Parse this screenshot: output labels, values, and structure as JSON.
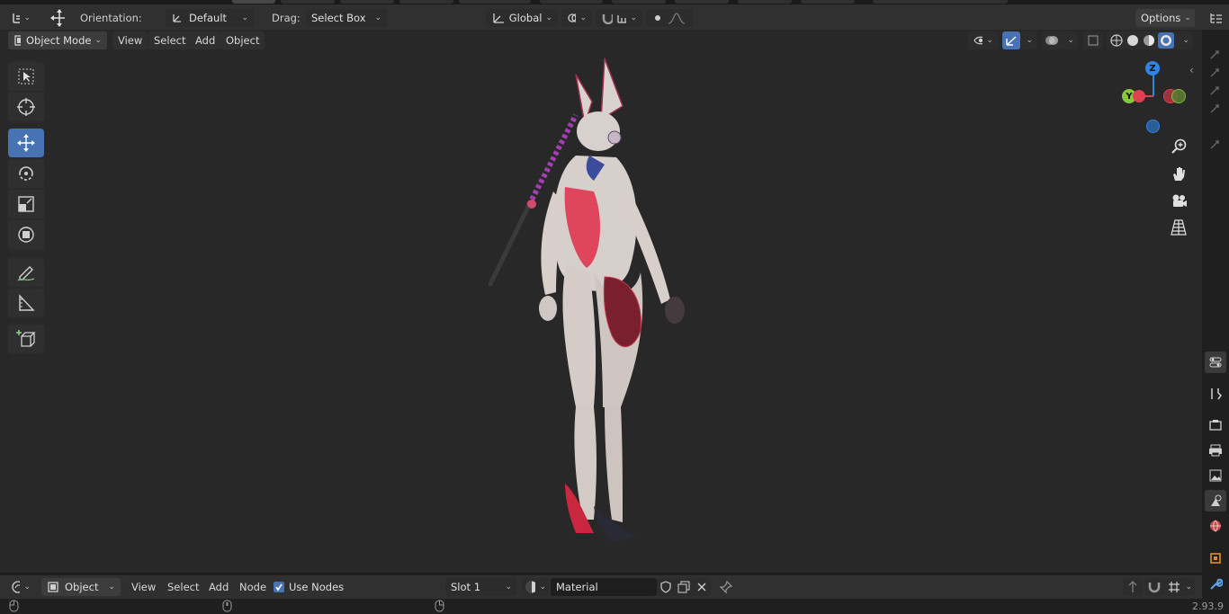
{
  "header": {
    "orientation_label": "Orientation:",
    "orientation_value": "Default",
    "drag_label": "Drag:",
    "drag_value": "Select Box",
    "transform_space": "Global",
    "options_label": "Options"
  },
  "viewport_header": {
    "mode": "Object Mode",
    "menus": [
      "View",
      "Select",
      "Add",
      "Object"
    ]
  },
  "toolbar": {
    "tools": [
      "select-box",
      "cursor",
      "move",
      "rotate",
      "scale",
      "transform",
      "annotate",
      "measure",
      "add-cube"
    ],
    "active": "move"
  },
  "gizmo": {
    "x": "",
    "y": "Y",
    "z": "Z"
  },
  "footer": {
    "editor_type": "Object",
    "menus": [
      "View",
      "Select",
      "Add",
      "Node"
    ],
    "use_nodes_label": "Use Nodes",
    "use_nodes_checked": true,
    "slot": "Slot 1",
    "material_name": "Material"
  },
  "status": {
    "version": "2.93.9"
  },
  "colors": {
    "accent": "#4772b3",
    "axis_x": "#e0414f",
    "axis_y": "#8bc53f",
    "axis_z": "#2f85e5",
    "viewport_bg": "#282828"
  }
}
